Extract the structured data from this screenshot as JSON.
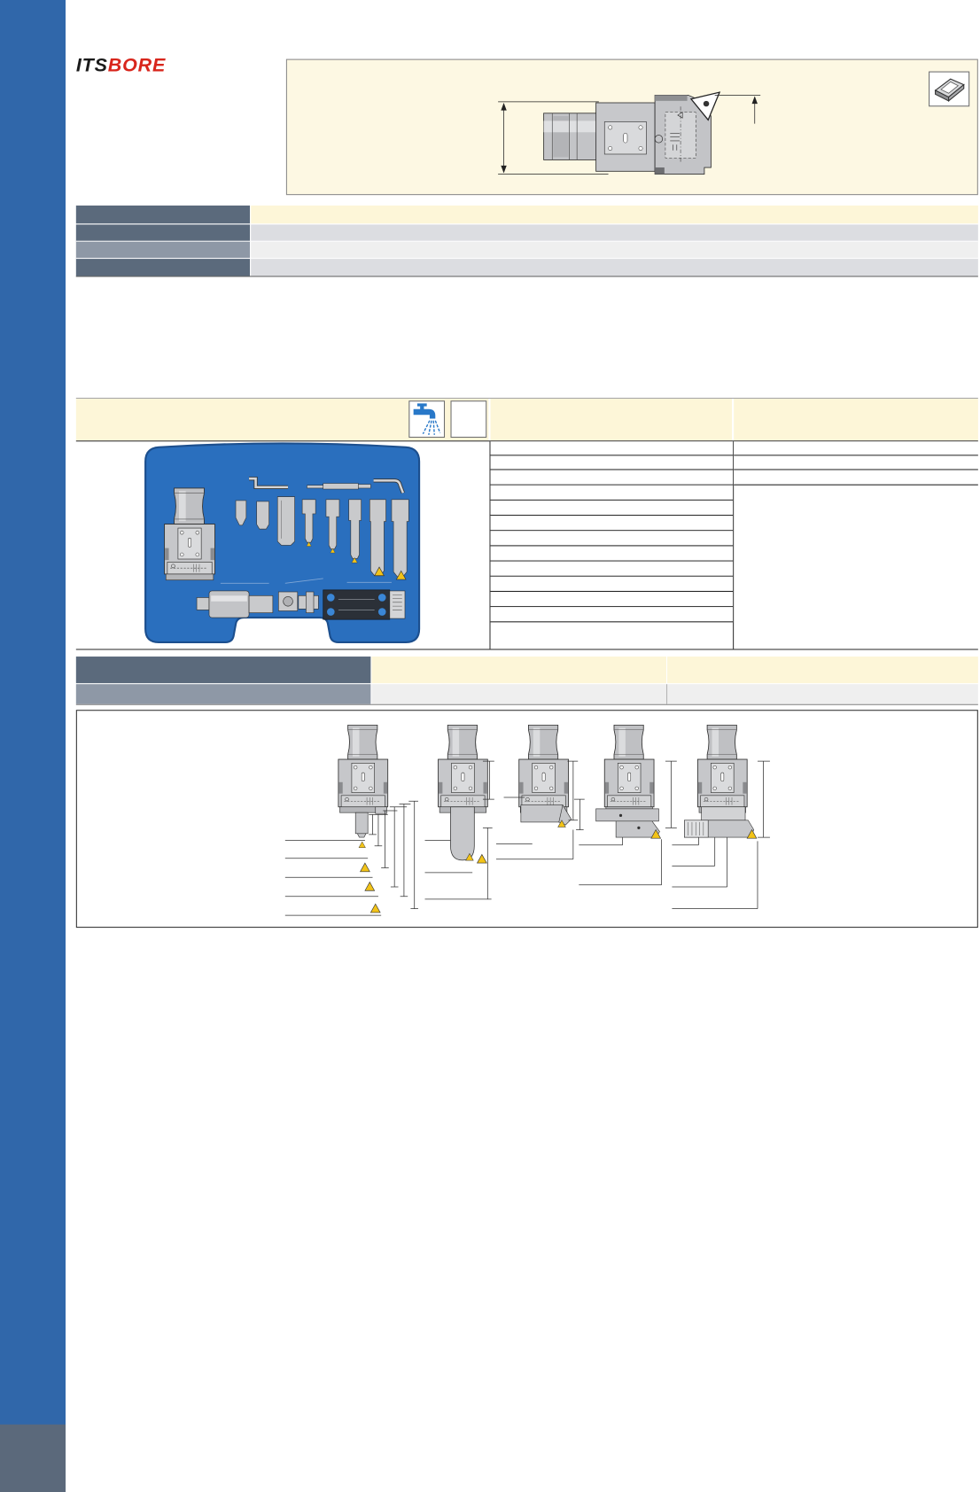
{
  "brand": {
    "logo_its": "ITS",
    "logo_bore": "BORE"
  },
  "colors": {
    "sidebar": "#3067aa",
    "sidebar_footer": "#5b697b",
    "header_dark": "#5b6a7c",
    "header_medium": "#8e98a6",
    "cream": "#fdf6d8",
    "row_gray": "#dcdde1",
    "row_light": "#efefef",
    "case_blue": "#2a6fbe",
    "insert_yellow": "#f2c318",
    "logo_red": "#d8261c"
  },
  "icons": {
    "insert_package": "insert-package-icon",
    "coolant": "coolant-icon"
  }
}
